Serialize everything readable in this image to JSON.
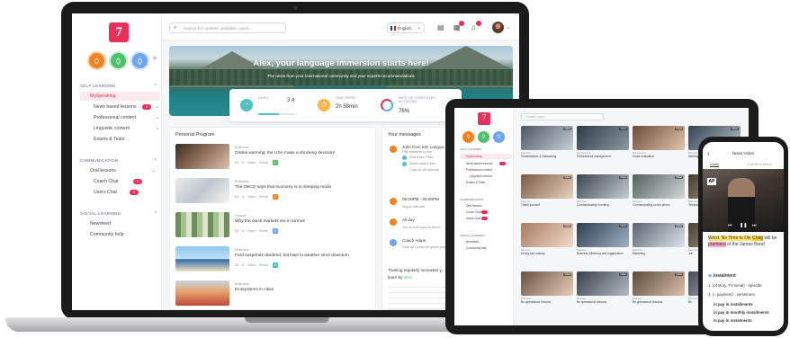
{
  "laptop": {
    "logo": "7",
    "sidebar_circles": [
      "◊",
      "◊",
      "◊"
    ],
    "plus": "+",
    "sections": {
      "self_learning": "SELF LEARNING",
      "communication": "COMMUNICATION",
      "social_learning": "SOCIAL LEARNING"
    },
    "items": {
      "myspeaking": "MySpeaking",
      "news_based": "News based lessons",
      "news_badge": "2",
      "professional": "Professional content",
      "linguistic": "Linguistic content",
      "exams": "Exams & Tests",
      "oral": "Oral lessons",
      "coach_chat": "Coach Chat",
      "coach_badge": "2",
      "users_chat": "Users Chat",
      "users_badge": "2",
      "newsfeed": "Newsfeed",
      "community": "Community help"
    },
    "search_placeholder": "Search for courses, activities, news...",
    "language": "English",
    "hero": {
      "title": "Alex, your language immersion starts here!",
      "subtitle": "The news from your international community and your experts recommendations"
    },
    "stats": {
      "level_label": "LEVEL",
      "level_value": "3.4",
      "level_progress": 0.55,
      "time_label": "TIME SPENT",
      "time_value": "2h 58min",
      "progress_label": "RATE OF COMPLETED ACTIVITIES",
      "progress_value": "76%"
    },
    "personal_program": {
      "title": "Personal Program",
      "lessons": [
        {
          "category": "Business",
          "title": "Global warming: the USA make a shocking decision!",
          "meta": "B1 · 6 · Video · 30min",
          "level": "1",
          "level_color": "#4ec26b"
        },
        {
          "category": "Business",
          "title": "The OECD says that economy is in sleeping mode",
          "meta": "B1 · 6 · Video · 30min",
          "level": "2",
          "level_color": "#f5821f"
        },
        {
          "category": "Finance",
          "title": "Why the stock markets are in turmoil",
          "meta": "B1 · 6 · Video · 30min",
          "level": "3",
          "level_color": "#6aa6f2"
        },
        {
          "category": "Business",
          "title": "Ford suspends dividend, borrows to weather virus downturn",
          "meta": "B1 · 6 · Video · 30min",
          "level": "3",
          "level_color": "#4ec2c2"
        },
        {
          "category": "Business",
          "title": "Ecosystems in cities",
          "meta": "",
          "level": "",
          "level_color": "#4ec26b"
        }
      ]
    },
    "messages": {
      "title": "Your messages",
      "items": [
        {
          "name": "John from ICE Langua...",
          "text": "Pay attention to the...",
          "dot": "#f5821f"
        },
        {
          "name": "Grammar: Past...",
          "text": "News based less...",
          "dot": "#4ec2c2"
        },
        {
          "name": "Copy of old lessons",
          "text": "",
          "dot": "#4ec2c2"
        }
      ],
      "event_time": "05:00PM - 06:00PM",
      "event_text": "Skype call with...",
      "all_day": "All day",
      "all_day_text": "You should have to finish...",
      "coach_name": "Coach Adam",
      "coach_text": "Note de travail de grand pour votre travail de fin",
      "training": "Training regularly increases y...",
      "training_suffix": "learn by",
      "training_pct": "45%"
    }
  },
  "tablet": {
    "logo": "7",
    "search": "Choose a topic",
    "sections": [
      "SELF LEARNING",
      "COMMUNICATION",
      "SOCIAL LEARNING"
    ],
    "items": [
      "MySpeaking",
      "News based lessons",
      "Professional content",
      "Linguistic content",
      "Exams & Tests",
      "Oral lessons",
      "Coach Chat",
      "Users Chat",
      "Newsfeed",
      "Community help"
    ],
    "tiles": [
      {
        "cat": "Business",
        "title": "Presentations & Networking",
        "tag": "Video"
      },
      {
        "cat": "Management",
        "title": "Performance management",
        "tag": "Video"
      },
      {
        "cat": "Management",
        "title": "Goals evaluation",
        "tag": "Video"
      },
      {
        "cat": "Business",
        "title": "Meetings",
        "tag": "Video"
      },
      {
        "cat": "Business",
        "title": "Travel yourself",
        "tag": "Video"
      },
      {
        "cat": "Business",
        "title": "Communicating in writing",
        "tag": "Video"
      },
      {
        "cat": "Business",
        "title": "Communicating on the phone",
        "tag": "Video"
      },
      {
        "cat": "Business",
        "title": "Telephone",
        "tag": "Video"
      },
      {
        "cat": "Business",
        "title": "Giving and making",
        "tag": "Video"
      },
      {
        "cat": "Business",
        "title": "Business efficiency and organization",
        "tag": "Video"
      },
      {
        "cat": "Business",
        "title": "Marketing",
        "tag": "Video"
      },
      {
        "cat": "Business",
        "title": "Job",
        "tag": "Video"
      },
      {
        "cat": "Business",
        "title": "Be operational: lessons",
        "tag": "Video"
      },
      {
        "cat": "Business",
        "title": "Be operational: lessons",
        "tag": "Video"
      },
      {
        "cat": "Business",
        "title": "Be operational: lessons",
        "tag": "Video"
      },
      {
        "cat": "Business",
        "title": "Be",
        "tag": "Video"
      }
    ]
  },
  "phone": {
    "header": "News Video",
    "back": "‹",
    "tab_video": "Video",
    "tab_previous": "Previous Week",
    "ap": "AP",
    "subtitle_pre": "Word. No Time to Die",
    "subtitle_hl1": "Craig",
    "subtitle_mid": "will be",
    "subtitle_hl2": "premiere",
    "subtitle_post": "of the James Bond",
    "def_word": "instalment",
    "def_lines": [
      "1. (of story, TV serial) · épisode",
      "2. (= payment) · versement",
      "in pay in installments",
      "in pay in monthly installments",
      "in pay in instalments"
    ]
  },
  "colors": {
    "brand": "#e8305a",
    "orange": "#f5821f",
    "green": "#4ec26b",
    "blue": "#6aa6f2",
    "teal": "#4ec2c2"
  }
}
